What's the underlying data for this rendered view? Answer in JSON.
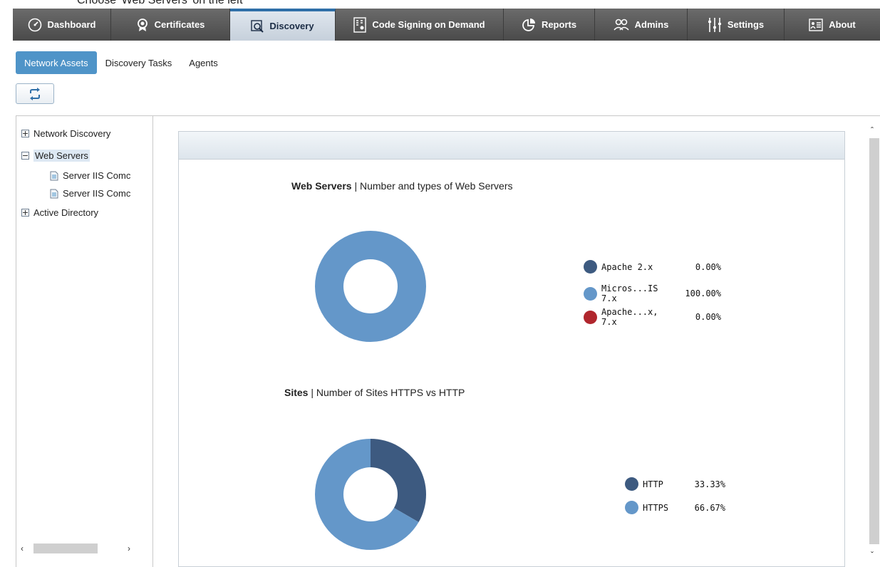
{
  "instruction": "Choose 'Web Servers' on the left",
  "nav": {
    "items": [
      {
        "label": "Dashboard",
        "icon": "dashboard-icon"
      },
      {
        "label": "Certificates",
        "icon": "certificate-icon"
      },
      {
        "label": "Discovery",
        "icon": "discovery-icon"
      },
      {
        "label": "Code Signing on Demand",
        "icon": "code-signing-icon"
      },
      {
        "label": "Reports",
        "icon": "reports-icon"
      },
      {
        "label": "Admins",
        "icon": "admins-icon"
      },
      {
        "label": "Settings",
        "icon": "settings-icon"
      },
      {
        "label": "About",
        "icon": "about-icon"
      }
    ],
    "active": "Discovery"
  },
  "subtabs": [
    "Network Assets",
    "Discovery Tasks",
    "Agents"
  ],
  "tree": {
    "network_discovery": "Network Discovery",
    "web_servers": "Web Servers",
    "child1": "Server IIS Comc",
    "child2": "Server IIS Comc",
    "active_directory": "Active Directory"
  },
  "charts": {
    "web_servers": {
      "title_bold": "Web Servers",
      "title_rest": "| Number and types of Web Servers"
    },
    "sites": {
      "title_bold": "Sites",
      "title_rest": "| Number of Sites HTTPS vs HTTP"
    }
  },
  "chart_data": [
    {
      "type": "pie",
      "title": "Web Servers | Number and types of Web Servers",
      "categories": [
        "Apache 2.x",
        "Micros...IS 7.x",
        "Apache...x, 7.x"
      ],
      "labels": [
        "Apache 2.x",
        "Micros...IS 7.x",
        "Apache...x, 7.x"
      ],
      "values": [
        0.0,
        100.0,
        0.0
      ],
      "value_labels": [
        "0.00%",
        "100.00%",
        "0.00%"
      ],
      "colors": [
        "#3d5a80",
        "#6497c9",
        "#b0262d"
      ],
      "legend": "right"
    },
    {
      "type": "pie",
      "title": "Sites | Number of Sites HTTPS vs HTTP",
      "categories": [
        "HTTP",
        "HTTPS"
      ],
      "labels": [
        "HTTP",
        "HTTPS"
      ],
      "values": [
        33.33,
        66.67
      ],
      "value_labels": [
        "33.33%",
        "66.67%"
      ],
      "colors": [
        "#3d5a80",
        "#6497c9"
      ],
      "legend": "right"
    }
  ]
}
